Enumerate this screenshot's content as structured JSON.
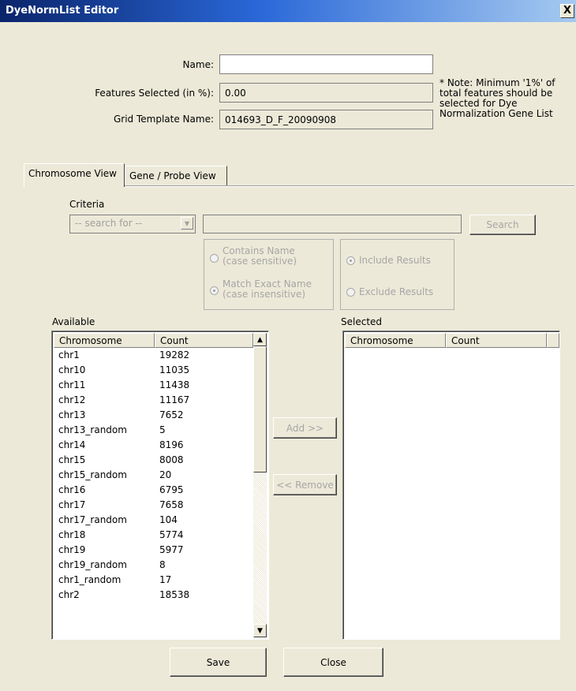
{
  "window": {
    "title": "DyeNormList Editor",
    "close_glyph": "X"
  },
  "form": {
    "name_label": "Name:",
    "name_value": "",
    "features_label": "Features Selected (in %):",
    "features_value": "0.00",
    "grid_label": "Grid Template Name:",
    "grid_value": "014693_D_F_20090908",
    "note": "* Note: Minimum '1%' of total features should be selected for Dye Normalization Gene List"
  },
  "tabs": [
    {
      "label": "Chromosome View",
      "active": true
    },
    {
      "label": "Gene / Probe View",
      "active": false
    }
  ],
  "criteria": {
    "label": "Criteria",
    "search_for": "-- search for --",
    "search_text": "",
    "search_button": "Search",
    "match_options": [
      "Contains Name\n(case sensitive)",
      "Match Exact Name\n(case insensitive)"
    ],
    "match_selected": 1,
    "result_options": [
      "Include Results",
      "Exclude Results"
    ],
    "result_selected": 0
  },
  "available": {
    "label": "Available",
    "columns": [
      "Chromosome",
      "Count"
    ],
    "rows": [
      [
        "chr1",
        "19282"
      ],
      [
        "chr10",
        "11035"
      ],
      [
        "chr11",
        "11438"
      ],
      [
        "chr12",
        "11167"
      ],
      [
        "chr13",
        "7652"
      ],
      [
        "chr13_random",
        "5"
      ],
      [
        "chr14",
        "8196"
      ],
      [
        "chr15",
        "8008"
      ],
      [
        "chr15_random",
        "20"
      ],
      [
        "chr16",
        "6795"
      ],
      [
        "chr17",
        "7658"
      ],
      [
        "chr17_random",
        "104"
      ],
      [
        "chr18",
        "5774"
      ],
      [
        "chr19",
        "5977"
      ],
      [
        "chr19_random",
        "8"
      ],
      [
        "chr1_random",
        "17"
      ],
      [
        "chr2",
        "18538"
      ]
    ]
  },
  "selected": {
    "label": "Selected",
    "columns": [
      "Chromosome",
      "Count"
    ],
    "rows": []
  },
  "transfer": {
    "add": "Add >>",
    "remove": "<< Remove"
  },
  "footer": {
    "save": "Save",
    "close": "Close"
  },
  "icons": {
    "scroll_up": "scroll-up-arrow-icon",
    "scroll_down": "scroll-down-arrow-icon",
    "dropdown": "dropdown-arrow-icon"
  }
}
